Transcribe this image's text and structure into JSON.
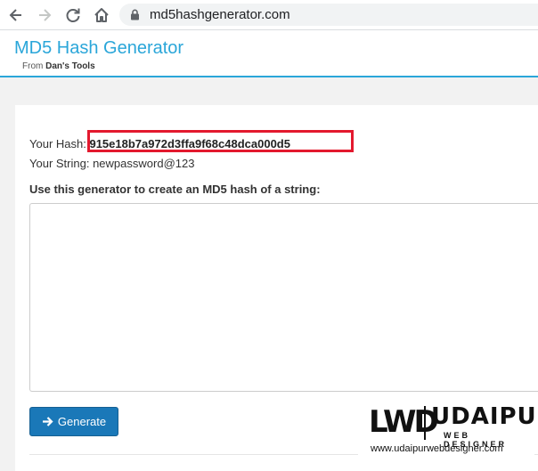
{
  "browser": {
    "url": "md5hashgenerator.com",
    "icons": [
      "back-arrow-icon",
      "forward-arrow-icon",
      "reload-icon",
      "home-icon",
      "lock-icon"
    ]
  },
  "site": {
    "title": "MD5 Hash Generator",
    "subtitle_prefix": "From ",
    "subtitle_brand": "Dan's Tools"
  },
  "result": {
    "hash_label": "Your Hash:",
    "hash_value": "915e18b7a972d3ffa9f68c48dca000d5",
    "string_label": "Your String:",
    "string_value": "newpassword@123"
  },
  "form": {
    "instruction": "Use this generator to create an MD5 hash of a string:",
    "textarea_value": "",
    "button_label": "Generate",
    "button_icon": "arrow-right-icon"
  },
  "watermark": {
    "logo": "LWD",
    "city": "UDAIPUR",
    "tagline": "WEB DESIGNER",
    "url": "www.udaipurwebdesigner.com"
  },
  "colors": {
    "brand_blue": "#2aa6d9",
    "button_blue": "#1a78b8",
    "highlight_red": "#e3192e"
  }
}
